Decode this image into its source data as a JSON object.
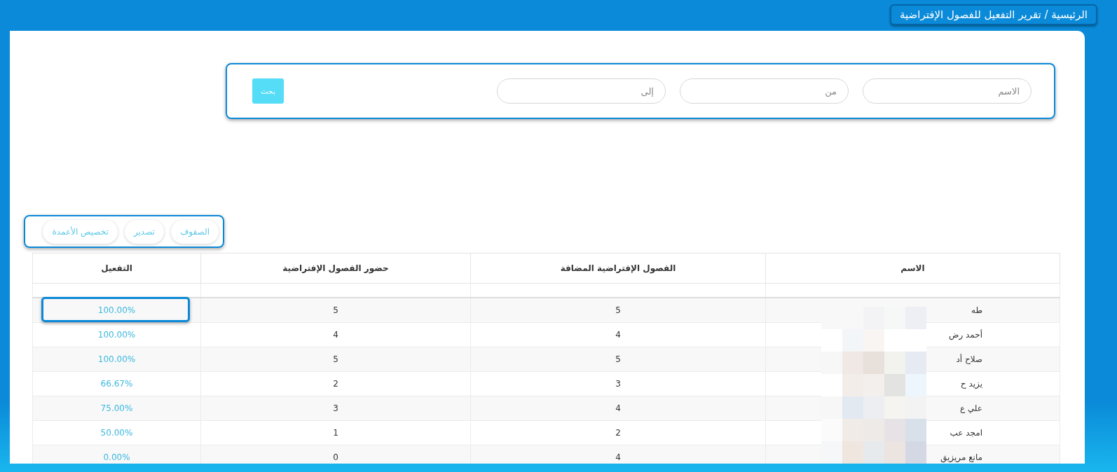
{
  "breadcrumb": "الرئيسية / تقرير التفعيل للفصول الإفتراضية",
  "search": {
    "fields": [
      {
        "placeholder": "الاسم"
      },
      {
        "placeholder": "من"
      },
      {
        "placeholder": "إلى"
      }
    ],
    "button": "بحث"
  },
  "toolbar": [
    "الصفوف",
    "تصدير",
    "تخصيص الأعمدة"
  ],
  "table": {
    "columns": [
      "الاسم",
      "الفصول الإفتراضية المضافة",
      "حضور الفصول الإفتراضية",
      "التفعيل"
    ],
    "rows": [
      {
        "name": "طه",
        "added": "5",
        "attended": "5",
        "activation": "100.00%"
      },
      {
        "name": "أحمد رض",
        "added": "4",
        "attended": "4",
        "activation": "100.00%"
      },
      {
        "name": "صلاح أد",
        "added": "5",
        "attended": "5",
        "activation": "100.00%"
      },
      {
        "name": "يزيد ح",
        "added": "3",
        "attended": "2",
        "activation": "66.67%"
      },
      {
        "name": "علي ع",
        "added": "4",
        "attended": "3",
        "activation": "75.00%"
      },
      {
        "name": "امجد عب",
        "added": "2",
        "attended": "1",
        "activation": "50.00%"
      },
      {
        "name": "مانع مريزيق",
        "added": "4",
        "attended": "0",
        "activation": "0.00%"
      }
    ]
  }
}
